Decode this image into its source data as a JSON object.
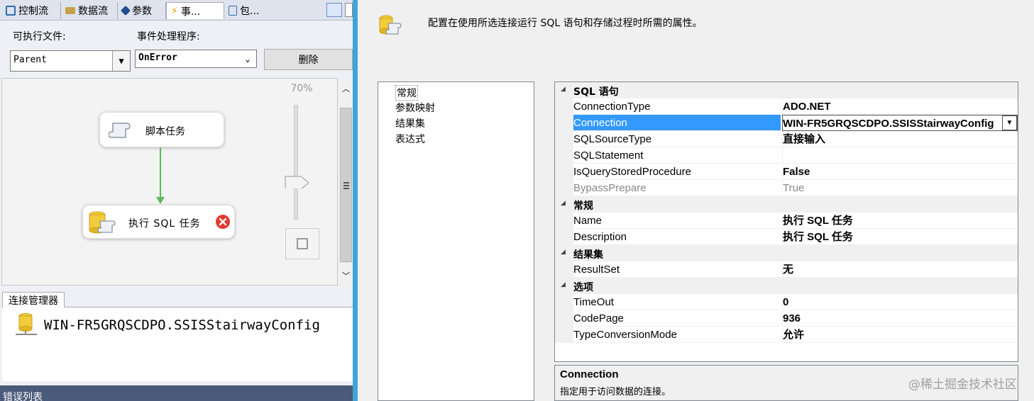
{
  "left": {
    "tabs": [
      {
        "label": "控制流",
        "icon": "control-flow-icon",
        "color": "#2b6cb0"
      },
      {
        "label": "数据流",
        "icon": "data-flow-icon",
        "color": "#8a6d3b"
      },
      {
        "label": "参数",
        "icon": "parameters-icon",
        "color": "#1f4e8c"
      },
      {
        "label": "事...",
        "icon": "event-handler-icon",
        "color": "#e0a000"
      },
      {
        "label": "包...",
        "icon": "package-explorer-icon",
        "color": "#2b6cb0"
      }
    ],
    "executable_label": "可执行文件:",
    "executable_value": "Parent",
    "event_handler_label": "事件处理程序:",
    "event_handler_value": "OnError",
    "delete_label": "删除",
    "zoom_label": "70%",
    "tasks": [
      {
        "label": "脚本任务",
        "icon": "script-task-icon"
      },
      {
        "label": "执行 SQL 任务",
        "icon": "execute-sql-task-icon",
        "status": "error"
      }
    ],
    "connection_managers_tab": "连接管理器",
    "connection_item": "WIN-FR5GRQSCDPO.SSISStairwayConfig",
    "error_list_label": "错误列表"
  },
  "dialog": {
    "header_description": "配置在使用所选连接运行 SQL 语句和存储过程时所需的属性。",
    "nav_items": [
      "常规",
      "参数映射",
      "结果集",
      "表达式"
    ],
    "selected_nav": "常规",
    "categories": [
      {
        "name": "SQL 语句",
        "props": [
          {
            "name": "ConnectionType",
            "value": "ADO.NET"
          },
          {
            "name": "Connection",
            "value": "WIN-FR5GRQSCDPO.SSISStairwayConfig",
            "selected": true
          },
          {
            "name": "SQLSourceType",
            "value": "直接输入"
          },
          {
            "name": "SQLStatement",
            "value": ""
          },
          {
            "name": "IsQueryStoredProcedure",
            "value": "False"
          },
          {
            "name": "BypassPrepare",
            "value": "True",
            "disabled": true
          }
        ]
      },
      {
        "name": "常规",
        "props": [
          {
            "name": "Name",
            "value": "执行 SQL 任务"
          },
          {
            "name": "Description",
            "value": "执行 SQL 任务"
          }
        ]
      },
      {
        "name": "结果集",
        "props": [
          {
            "name": "ResultSet",
            "value": "无"
          }
        ]
      },
      {
        "name": "选项",
        "props": [
          {
            "name": "TimeOut",
            "value": "0"
          },
          {
            "name": "CodePage",
            "value": "936"
          },
          {
            "name": "TypeConversionMode",
            "value": "允许"
          }
        ]
      }
    ],
    "description_title": "Connection",
    "description_text": "指定用于访问数据的连接。",
    "selection_color": "#3399ff"
  },
  "watermark": "@稀土掘金技术社区"
}
